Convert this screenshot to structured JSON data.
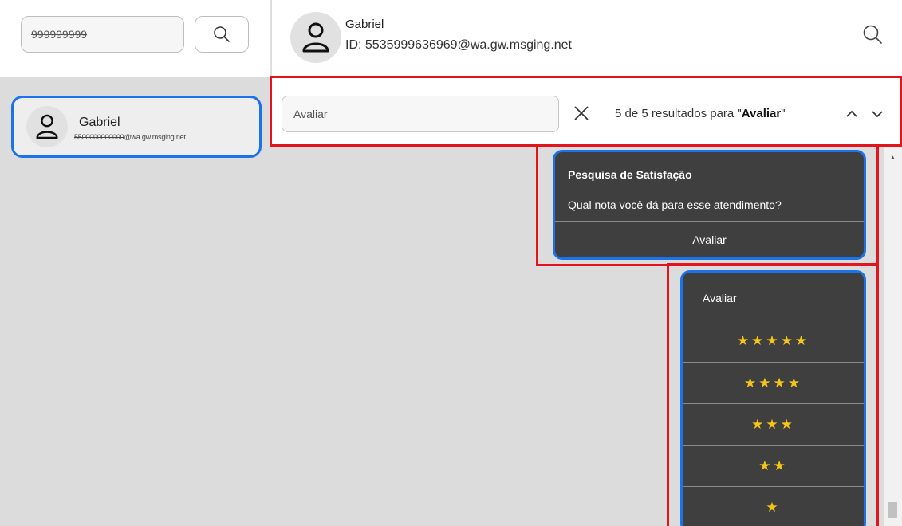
{
  "sidebar": {
    "phone_search": {
      "value": "999999999"
    },
    "contact": {
      "name": "Gabriel",
      "id_hidden": "5500000000000",
      "id_domain": "@wa.gw.msging.net"
    }
  },
  "header": {
    "name": "Gabriel",
    "id_prefix": "ID: ",
    "id_hidden": "5535999636969",
    "id_domain": "@wa.gw.msging.net"
  },
  "find_bar": {
    "query": "Avaliar",
    "results_prefix": "5 de 5 resultados para \"",
    "results_term": "Avaliar",
    "results_suffix": "\""
  },
  "messages": {
    "survey": {
      "title": "Pesquisa de Satisfação",
      "question": "Qual nota você dá para esse atendimento?",
      "button": "Avaliar"
    },
    "rating": {
      "title": "Avaliar",
      "options": [
        "★★★★★",
        "★★★★",
        "★★★",
        "★★",
        "★"
      ]
    }
  },
  "colors": {
    "highlight": "#e2141c",
    "selection": "#1a73e8",
    "card_bg": "#3f3f3f",
    "star": "#f5c518"
  }
}
